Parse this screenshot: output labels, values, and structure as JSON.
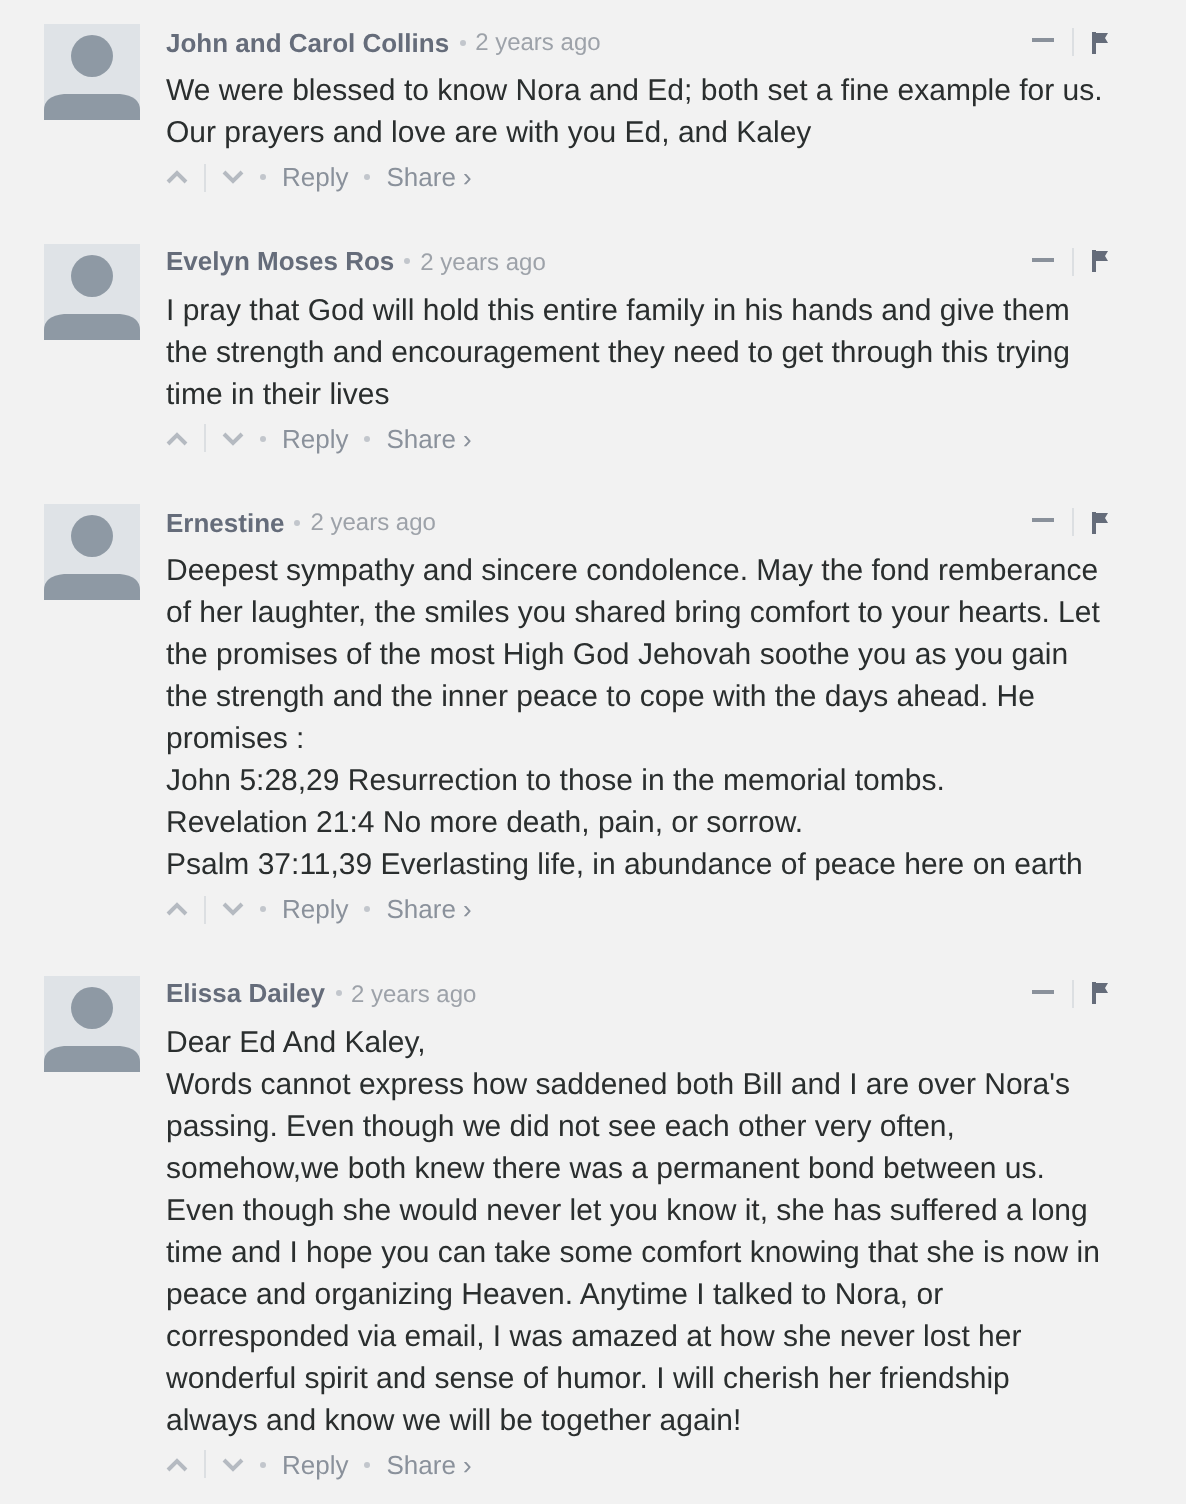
{
  "comments": [
    {
      "author": "John and Carol Collins",
      "time": "2 years ago",
      "body": "We were blessed to know Nora and Ed; both set a fine example for us.\nOur prayers and love are with you Ed, and Kaley",
      "reply": "Reply",
      "share": "Share ›"
    },
    {
      "author": "Evelyn Moses Ros",
      "time": "2 years ago",
      "body": "I pray that God will hold this entire family in his hands and give them\nthe strength and encouragement they need to get through this trying\ntime in their lives",
      "reply": "Reply",
      "share": "Share ›"
    },
    {
      "author": "Ernestine",
      "time": "2 years ago",
      "body": "Deepest sympathy and sincere condolence. May the fond remberance\nof her laughter, the smiles you shared bring comfort to your hearts. Let\nthe promises of the most High God Jehovah soothe you as you gain\nthe strength and the inner peace to cope with the days ahead. He\npromises :\nJohn 5:28,29 Resurrection to those in the memorial tombs.\nRevelation 21:4 No more death, pain, or sorrow.\nPsalm 37:11,39 Everlasting life, in abundance of peace here on earth",
      "reply": "Reply",
      "share": "Share ›"
    },
    {
      "author": "Elissa Dailey",
      "time": "2 years ago",
      "body": "Dear Ed And Kaley,\nWords cannot express how saddened both Bill and I are over Nora's\npassing. Even though we did not see each other very often,\nsomehow,we both knew there was a permanent bond between us.\nEven though she would never let you know it, she has suffered a long\ntime and I hope you can take some comfort knowing that she is now in\npeace and organizing Heaven. Anytime I talked to Nora, or\ncorresponded via email, I was amazed at how she never lost her\nwonderful spirit and sense of humor. I will cherish her friendship\nalways and know we will be together again!",
      "reply": "Reply",
      "share": "Share ›"
    }
  ]
}
